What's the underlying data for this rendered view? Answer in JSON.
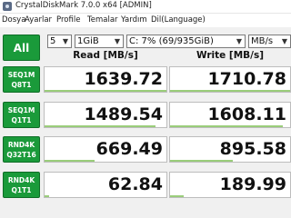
{
  "title": "CrystalDiskMark 7.0.0 x64 [ADMIN]",
  "menu": [
    "Dosya",
    "Ayarlar",
    "Profile",
    "Temalar",
    "Yardım",
    "Dil(Language)"
  ],
  "toolbar": {
    "all_label": "All",
    "count": "5",
    "size": "1GiB",
    "drive": "C: 7% (69/935GiB)",
    "unit": "MB/s"
  },
  "headers": {
    "read": "Read [MB/s]",
    "write": "Write [MB/s]"
  },
  "rows": [
    {
      "label1": "SEQ1M",
      "label2": "Q8T1",
      "read": "1639.72",
      "write": "1710.78",
      "read_fill": 1.0,
      "write_fill": 1.0
    },
    {
      "label1": "SEQ1M",
      "label2": "Q1T1",
      "read": "1489.54",
      "write": "1608.11",
      "read_fill": 0.91,
      "write_fill": 0.94
    },
    {
      "label1": "RND4K",
      "label2": "Q32T16",
      "read": "669.49",
      "write": "895.58",
      "read_fill": 0.41,
      "write_fill": 0.52
    },
    {
      "label1": "RND4K",
      "label2": "Q1T1",
      "read": "62.84",
      "write": "189.99",
      "read_fill": 0.04,
      "write_fill": 0.11
    }
  ],
  "colors": {
    "accent": "#1a9a3a",
    "bar": "#9acd7a"
  }
}
